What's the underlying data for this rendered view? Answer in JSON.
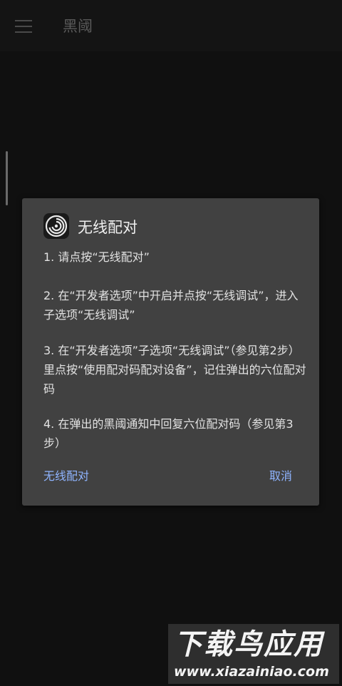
{
  "appbar": {
    "menu_icon": "hamburger-menu-icon",
    "title": "黑阈"
  },
  "dialog": {
    "icon": "swirl-app-icon",
    "title": "无线配对",
    "steps": [
      "1. 请点按“无线配对”",
      "2. 在“开发者选项”中开启并点按“无线调试”，进入子选项“无线调试”",
      "3. 在“开发者选项”子选项“无线调试”（参见第2步）里点按“使用配对码配对设备”，记住弹出的六位配对码",
      "4. 在弹出的黑阈通知中回复六位配对码（参见第3步）"
    ],
    "positive_button": "无线配对",
    "negative_button": "取消",
    "button_color": "#8fb4ff"
  },
  "watermark": {
    "text": "下载鸟应用",
    "url": "www.xiazainiao.com"
  }
}
